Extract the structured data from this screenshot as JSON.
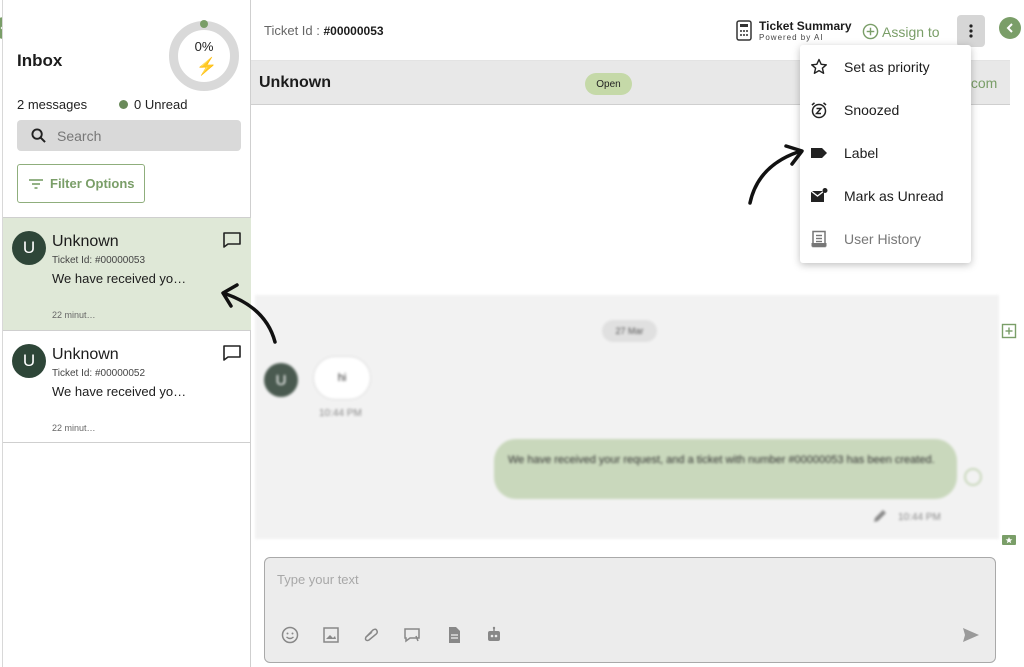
{
  "sidebar": {
    "title": "Inbox",
    "progress_percent": "0%",
    "progress_value": 0,
    "message_count": "2 messages",
    "unread_count": "0 Unread",
    "search_placeholder": "Search",
    "filter_label": "Filter Options",
    "tickets": [
      {
        "initial": "U",
        "name": "Unknown",
        "ticket_id": "Ticket Id: #00000053",
        "preview": "We have received yo…",
        "time": "22 minut…",
        "active": true
      },
      {
        "initial": "U",
        "name": "Unknown",
        "ticket_id": "Ticket Id: #00000052",
        "preview": "We have received yo…",
        "time": "22 minut…",
        "active": false
      }
    ]
  },
  "topbar": {
    "ticket_id_label": "Ticket Id : ",
    "ticket_id_value": "#00000053",
    "summary_title": "Ticket Summary",
    "summary_sub": "Powered by AI",
    "assign_label": "Assign to"
  },
  "conversation": {
    "name": "Unknown",
    "status": "Open",
    "email_fragment": ".com",
    "date_pill": "27 Mar",
    "avatar_initial": "U",
    "incoming_text": "hi",
    "incoming_time": "10:44 PM",
    "outgoing_text": "We have received your request, and a ticket with number #00000053 has been created.",
    "outgoing_time": "10:44 PM"
  },
  "composer": {
    "placeholder": "Type your text"
  },
  "menu": {
    "items": [
      {
        "label": "Set as priority",
        "icon": "star-outline-icon"
      },
      {
        "label": "Snoozed",
        "icon": "snooze-clock-icon"
      },
      {
        "label": "Label",
        "icon": "label-tag-icon"
      },
      {
        "label": "Mark as Unread",
        "icon": "mark-unread-mail-icon"
      },
      {
        "label": "User History",
        "icon": "user-history-icon"
      }
    ]
  },
  "colors": {
    "accent": "#7a9e68",
    "active_ticket_bg": "#dfe8d7",
    "avatar_bg": "#2e4638",
    "status_badge_bg": "#c5d9a8",
    "outgoing_bubble": "#c9d8bc"
  }
}
